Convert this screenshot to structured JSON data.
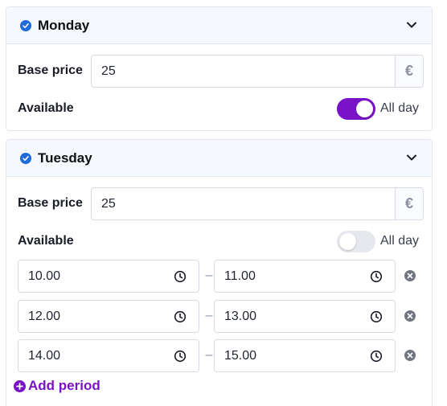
{
  "days": [
    {
      "name": "Monday",
      "base_price_label": "Base price",
      "base_price": "25",
      "currency": "€",
      "available_label": "Available",
      "all_day_label": "All day",
      "all_day_enabled": true
    },
    {
      "name": "Tuesday",
      "base_price_label": "Base price",
      "base_price": "25",
      "currency": "€",
      "available_label": "Available",
      "all_day_label": "All day",
      "all_day_enabled": false,
      "periods": [
        {
          "start": "10.00",
          "end": "11.00"
        },
        {
          "start": "12.00",
          "end": "13.00"
        },
        {
          "start": "14.00",
          "end": "15.00"
        }
      ],
      "separator": "–",
      "add_period_label": "Add period"
    }
  ],
  "colors": {
    "accent": "#7a12c8",
    "check_blue": "#1e6bd9",
    "header_bg": "#f5f8fd"
  },
  "icons": {
    "day_check": "check-circle-icon",
    "collapse": "chevron-down-icon",
    "time": "clock-icon",
    "remove": "x-circle-icon",
    "add": "plus-circle-icon"
  }
}
